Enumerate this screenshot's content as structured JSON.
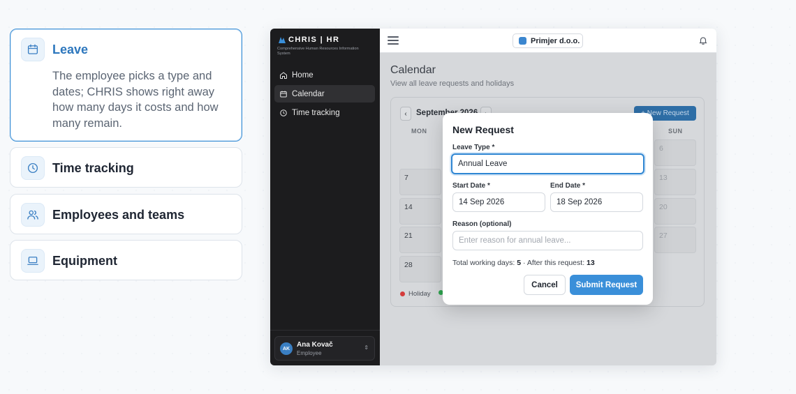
{
  "features": [
    {
      "icon": "calendar-icon",
      "title": "Leave",
      "description": "The employee picks a type and dates; CHRIS shows right away how many days it costs and how many remain.",
      "active": true
    },
    {
      "icon": "clock-icon",
      "title": "Time tracking",
      "active": false
    },
    {
      "icon": "users-icon",
      "title": "Employees and teams",
      "active": false
    },
    {
      "icon": "laptop-icon",
      "title": "Equipment",
      "active": false
    }
  ],
  "app": {
    "logo": "CHRIS | HR",
    "logo_sub": "Comprehensive Human Resources Information System",
    "nav": [
      {
        "icon": "home-icon",
        "label": "Home",
        "active": false
      },
      {
        "icon": "calendar-icon",
        "label": "Calendar",
        "active": true
      },
      {
        "icon": "clock-icon",
        "label": "Time tracking",
        "active": false
      }
    ],
    "user": {
      "initials": "AK",
      "name": "Ana Kovač",
      "role": "Employee"
    },
    "company": "Primjer d.o.o.",
    "page_title": "Calendar",
    "page_subtitle": "View all leave requests and holidays",
    "calendar": {
      "month": "September 2026",
      "new_request_label": "+ New Request",
      "weekdays": {
        "mon": "MON",
        "sun": "SUN"
      },
      "mon_column": [
        "7",
        "14",
        "21",
        "28"
      ],
      "sun_column": [
        "6",
        "13",
        "20",
        "27"
      ],
      "legend": {
        "holiday": "Holiday"
      }
    }
  },
  "modal": {
    "title": "New Request",
    "leave_type_label": "Leave Type *",
    "leave_type_value": "Annual Leave",
    "start_label": "Start Date *",
    "start_value": "14 Sep 2026",
    "end_label": "End Date *",
    "end_value": "18 Sep 2026",
    "reason_label": "Reason (optional)",
    "reason_placeholder": "Enter reason for annual leave...",
    "summary_prefix": "Total working days:",
    "summary_days": "5",
    "summary_mid": "· After this request:",
    "summary_remaining": "13",
    "cancel_label": "Cancel",
    "submit_label": "Submit Request"
  },
  "colors": {
    "accent": "#3a8fd9",
    "sidebar": "#1c1c1e",
    "holiday": "#d43c3c",
    "approved": "#2ea44f"
  }
}
